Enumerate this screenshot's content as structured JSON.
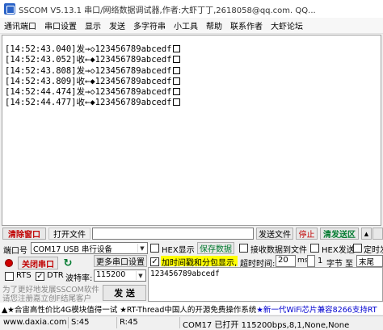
{
  "window": {
    "title": "SSCOM V5.13.1 串口/网络数据调试器,作者:大虾丁丁,2618058@qq.com. QQ..."
  },
  "menu": [
    "通讯端口",
    "串口设置",
    "显示",
    "发送",
    "多字符串",
    "小工具",
    "帮助",
    "联系作者",
    "大虾论坛"
  ],
  "receive": {
    "lines": [
      {
        "time": "[14:52:43.040]",
        "dir": "发→◇",
        "data": "123456789abcedf"
      },
      {
        "time": "[14:52:43.052]",
        "dir": "收←◆",
        "data": "123456789abcedf"
      },
      {
        "time": "[14:52:43.808]",
        "dir": "发→◇",
        "data": "123456789abcedf"
      },
      {
        "time": "[14:52:43.809]",
        "dir": "收←◆",
        "data": "123456789abcedf"
      },
      {
        "time": "[14:52:44.474]",
        "dir": "发→◇",
        "data": "123456789abcedf"
      },
      {
        "time": "[14:52:44.477]",
        "dir": "收←◆",
        "data": "123456789abcedf"
      }
    ]
  },
  "toolbar": {
    "clear_window": "清除窗口",
    "open_file": "打开文件",
    "send_file": "发送文件",
    "stop": "停止",
    "clear_send": "清发送区",
    "up_arrow": "▲"
  },
  "port": {
    "port_label": "端口号",
    "port_value": "COM17 USB 串行设备",
    "more_settings": "更多串口设置",
    "close_port": "关闭串口",
    "rts": "RTS",
    "dtr": "DTR",
    "baud_label": "波特率:",
    "baud_value": "115200",
    "hint_line1": "为了更好地发展SSCOM软件",
    "hint_line2": "请您注册嘉立创F结尾客户",
    "send_button": "发 送"
  },
  "options": {
    "hex_display": "HEX显示",
    "save_data": "保存数据",
    "recv_to_file": "接收数据到文件",
    "hex_send": "HEX发送",
    "timed_send": "定时发",
    "timestamp": "加时间戳和分包显示,",
    "timeout_label": "超时时间:",
    "timeout_value": "20",
    "timeout_unit": "ms",
    "byte_no": "1",
    "byte_label": "字节 至",
    "end_value": "末尾"
  },
  "send_text": "123456789abcedf",
  "promo": {
    "part1": "▲★合宙高性价比4G模块值得一试 ★RT-Thread中国人的开源免费操作系统 ",
    "part2": "★新一代WiFi芯片兼容8266支持RT"
  },
  "status": {
    "website": "www.daxia.com",
    "sent": "S:45",
    "received": "R:45",
    "port_state": "COM17 已打开  115200bps,8,1,None,None"
  }
}
